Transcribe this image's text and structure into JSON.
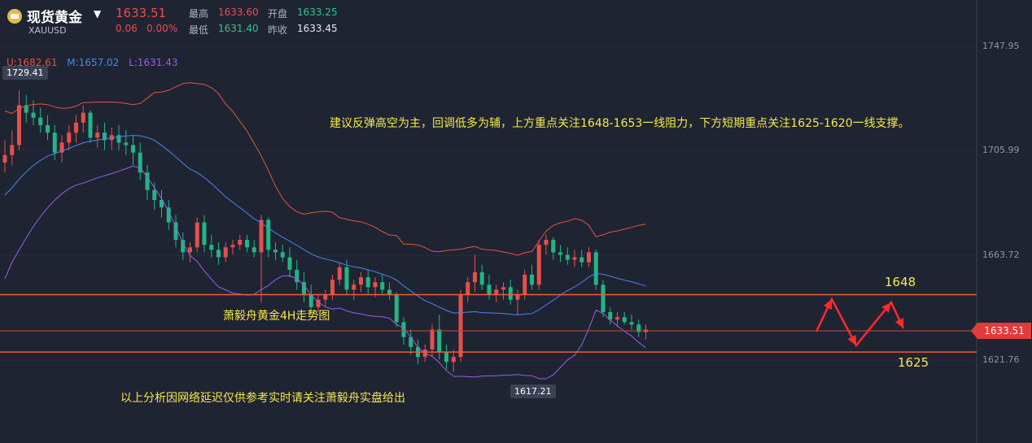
{
  "header": {
    "name": "现货黄金",
    "symbol": "XAUUSD",
    "price": "1633.51",
    "change": "0.06",
    "change_pct": "0.00%",
    "high_label": "最高",
    "high": "1633.60",
    "low_label": "最低",
    "low": "1631.40",
    "open_label": "开盘",
    "open": "1633.25",
    "prev_label": "昨收",
    "prev_close": "1633.45"
  },
  "bollinger": {
    "upper": "U:1682.61",
    "middle": "M:1657.02",
    "lower": "L:1631.43"
  },
  "annotations": {
    "strategy": "建议反弹高空为主，回调低多为辅，上方重点关注1648-1653一线阻力，下方短期重点关注1625-1620一线支撑。",
    "chart_name": "萧毅舟黄金4H走势图",
    "disclaimer": "以上分析因网络延迟仅供参考实时请关注萧毅舟实盘给出",
    "level_high": "1648",
    "level_low": "1625",
    "max_label": "1729.41",
    "min_label": "1617.21",
    "current_price": "1633.51"
  },
  "colors": {
    "up": "#e5504b",
    "down": "#21b684",
    "upper_band": "#e3533d",
    "middle_band": "#4a86e8",
    "lower_band": "#9b5de5",
    "level_line": "#ef5a3a",
    "forecast": "#ff2a2a"
  },
  "chart_data": {
    "type": "candlestick",
    "y_ticks": [
      "1747.95",
      "1705.99",
      "1663.72",
      "1621.76"
    ],
    "y_tick_values": [
      1747.95,
      1705.99,
      1663.72,
      1621.76
    ],
    "horizontal_levels": [
      1648,
      1633.51,
      1625
    ],
    "ohlc": [
      [
        1701,
        1710,
        1697,
        1704
      ],
      [
        1704,
        1714,
        1700,
        1708
      ],
      [
        1708,
        1730,
        1706,
        1724
      ],
      [
        1724,
        1728,
        1717,
        1721
      ],
      [
        1721,
        1726,
        1716,
        1719
      ],
      [
        1719,
        1723,
        1713,
        1716
      ],
      [
        1716,
        1720,
        1710,
        1713
      ],
      [
        1713,
        1716,
        1702,
        1705
      ],
      [
        1705,
        1712,
        1701,
        1709
      ],
      [
        1709,
        1716,
        1706,
        1713
      ],
      [
        1713,
        1720,
        1709,
        1717
      ],
      [
        1717,
        1724,
        1713,
        1721
      ],
      [
        1721,
        1722,
        1709,
        1711
      ],
      [
        1711,
        1716,
        1707,
        1713
      ],
      [
        1713,
        1717,
        1706,
        1710
      ],
      [
        1710,
        1715,
        1706,
        1712
      ],
      [
        1712,
        1716,
        1706,
        1709
      ],
      [
        1709,
        1714,
        1704,
        1708
      ],
      [
        1708,
        1712,
        1700,
        1705
      ],
      [
        1705,
        1709,
        1694,
        1697
      ],
      [
        1697,
        1700,
        1686,
        1690
      ],
      [
        1690,
        1693,
        1682,
        1686
      ],
      [
        1686,
        1690,
        1679,
        1683
      ],
      [
        1683,
        1686,
        1674,
        1677
      ],
      [
        1677,
        1680,
        1667,
        1670
      ],
      [
        1670,
        1673,
        1662,
        1665
      ],
      [
        1665,
        1669,
        1661,
        1667
      ],
      [
        1667,
        1679,
        1665,
        1677
      ],
      [
        1677,
        1680,
        1665,
        1668
      ],
      [
        1668,
        1672,
        1663,
        1666
      ],
      [
        1666,
        1669,
        1660,
        1663
      ],
      [
        1663,
        1669,
        1661,
        1667
      ],
      [
        1667,
        1670,
        1664,
        1668
      ],
      [
        1668,
        1672,
        1666,
        1670
      ],
      [
        1670,
        1672,
        1665,
        1667
      ],
      [
        1667,
        1670,
        1663,
        1665
      ],
      [
        1665,
        1680,
        1645,
        1678
      ],
      [
        1678,
        1679,
        1663,
        1666
      ],
      [
        1666,
        1669,
        1662,
        1665
      ],
      [
        1665,
        1668,
        1661,
        1663
      ],
      [
        1663,
        1667,
        1655,
        1658
      ],
      [
        1658,
        1662,
        1650,
        1653
      ],
      [
        1653,
        1657,
        1645,
        1648
      ],
      [
        1648,
        1652,
        1640,
        1643
      ],
      [
        1643,
        1648,
        1641,
        1646
      ],
      [
        1646,
        1650,
        1643,
        1648
      ],
      [
        1648,
        1656,
        1646,
        1654
      ],
      [
        1654,
        1661,
        1652,
        1659
      ],
      [
        1659,
        1662,
        1648,
        1650
      ],
      [
        1650,
        1654,
        1646,
        1652
      ],
      [
        1652,
        1657,
        1649,
        1655
      ],
      [
        1655,
        1658,
        1648,
        1651
      ],
      [
        1651,
        1655,
        1647,
        1653
      ],
      [
        1653,
        1656,
        1648,
        1650
      ],
      [
        1650,
        1653,
        1646,
        1648
      ],
      [
        1648,
        1649,
        1635,
        1637
      ],
      [
        1637,
        1639,
        1628,
        1631
      ],
      [
        1631,
        1634,
        1624,
        1627
      ],
      [
        1627,
        1630,
        1620,
        1623
      ],
      [
        1623,
        1628,
        1621,
        1626
      ],
      [
        1626,
        1636,
        1623,
        1634
      ],
      [
        1634,
        1640,
        1622,
        1625
      ],
      [
        1625,
        1628,
        1618,
        1621
      ],
      [
        1621,
        1626,
        1617,
        1623
      ],
      [
        1623,
        1650,
        1621,
        1648
      ],
      [
        1648,
        1655,
        1645,
        1653
      ],
      [
        1653,
        1664,
        1649,
        1657
      ],
      [
        1657,
        1660,
        1650,
        1652
      ],
      [
        1652,
        1656,
        1646,
        1648
      ],
      [
        1648,
        1652,
        1645,
        1650
      ],
      [
        1650,
        1653,
        1646,
        1651
      ],
      [
        1651,
        1654,
        1644,
        1646
      ],
      [
        1646,
        1650,
        1640,
        1648
      ],
      [
        1648,
        1658,
        1646,
        1656
      ],
      [
        1656,
        1660,
        1650,
        1652
      ],
      [
        1652,
        1670,
        1650,
        1668
      ],
      [
        1668,
        1672,
        1664,
        1670
      ],
      [
        1670,
        1671,
        1662,
        1665
      ],
      [
        1665,
        1668,
        1661,
        1664
      ],
      [
        1664,
        1667,
        1660,
        1662
      ],
      [
        1662,
        1666,
        1659,
        1663
      ],
      [
        1663,
        1666,
        1659,
        1661
      ],
      [
        1661,
        1667,
        1659,
        1665
      ],
      [
        1665,
        1666,
        1650,
        1652
      ],
      [
        1652,
        1654,
        1639,
        1641
      ],
      [
        1641,
        1643,
        1636,
        1638
      ],
      [
        1638,
        1641,
        1635,
        1639
      ],
      [
        1639,
        1641,
        1636,
        1637
      ],
      [
        1637,
        1640,
        1634,
        1636
      ],
      [
        1636,
        1638,
        1631,
        1633
      ],
      [
        1633,
        1636,
        1630,
        1634
      ]
    ]
  }
}
